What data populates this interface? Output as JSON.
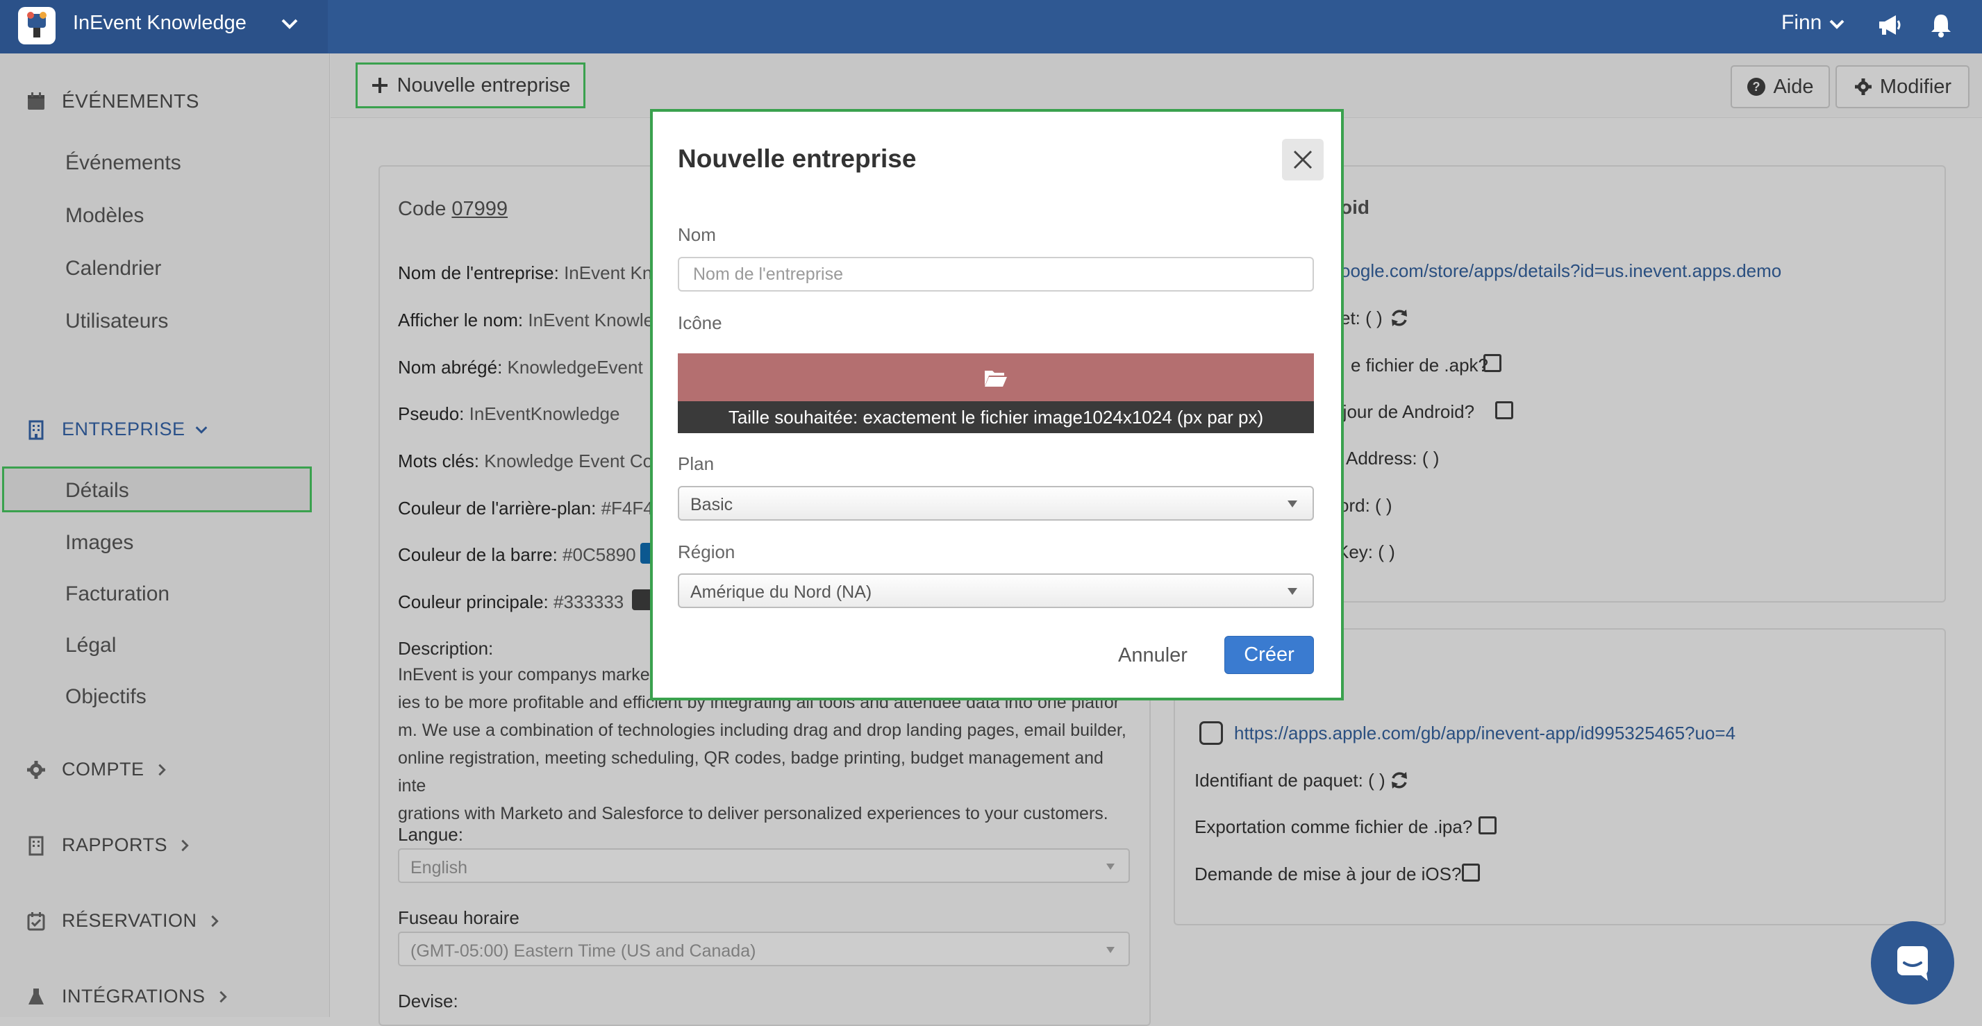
{
  "app": {
    "title": "InEvent Knowledge"
  },
  "user": {
    "name": "Finn"
  },
  "sidebar": {
    "events_header": "ÉVÉNEMENTS",
    "events_items": [
      "Événements",
      "Modèles",
      "Calendrier",
      "Utilisateurs"
    ],
    "company_header": "ENTREPRISE",
    "company_items": [
      "Détails",
      "Images",
      "Facturation",
      "Légal",
      "Objectifs"
    ],
    "account_header": "COMPTE",
    "reports_header": "RAPPORTS",
    "reservation_header": "RÉSERVATION",
    "integrations_header": "INTÉGRATIONS"
  },
  "toolbar": {
    "new_company": "Nouvelle entreprise",
    "help": "Aide",
    "edit": "Modifier"
  },
  "details": {
    "code_label": "Code",
    "code_value": "07999",
    "company_name_label": "Nom de l'entreprise:",
    "company_name_value": "InEvent Kno",
    "display_name_label": "Afficher le nom:",
    "display_name_value": "InEvent Knowle",
    "short_name_label": "Nom abrégé:",
    "short_name_value": "KnowledgeEvent",
    "nickname_label": "Pseudo:",
    "nickname_value": "InEventKnowledge",
    "keywords_label": "Mots clés:",
    "keywords_value": "Knowledge Event Cor",
    "bg_color_label": "Couleur de l'arrière-plan:",
    "bg_color_value": "#F4F4",
    "bar_color_label": "Couleur de la barre:",
    "bar_color_value": "#0C5890",
    "main_color_label": "Couleur principale:",
    "main_color_value": "#333333",
    "description_label": "Description:",
    "description_lines": [
      "InEvent is your companys market",
      "ies to be more profitable and efficient by integrating all tools and attendee data into one platfor",
      "m. We use a combination of technologies including drag and drop landing pages, email builder,",
      "online registration, meeting scheduling, QR codes, badge printing, budget management and inte",
      "grations with Marketo and Salesforce to deliver personalized experiences to your customers."
    ],
    "language_label": "Langue:",
    "language_value": "English",
    "timezone_label": "Fuseau horaire",
    "timezone_value": "(GMT-05:00) Eastern Time (US and Canada)",
    "currency_label": "Devise:"
  },
  "android": {
    "title": "oid",
    "store_link": "oogle.com/store/apps/details?id=us.inevent.apps.demo",
    "package_label": "et: ( )",
    "export_label": "e fichier de .apk?",
    "update_label": "à jour de Android?",
    "address_label": "Address: ( )",
    "password_label": "ord: ( )",
    "key_label": "Key: ( )"
  },
  "ios": {
    "store_link": "https://apps.apple.com/gb/app/inevent-app/id995325465?uo=4",
    "package_label": "Identifiant de paquet: ( )",
    "export_label": "Exportation comme fichier de .ipa?",
    "update_label": "Demande de mise à jour de iOS?"
  },
  "modal": {
    "title": "Nouvelle entreprise",
    "name_label": "Nom",
    "name_placeholder": "Nom de l'entreprise",
    "icon_label": "Icône",
    "size_hint": "Taille souhaitée: exactement le fichier image1024x1024 (px par px)",
    "plan_label": "Plan",
    "plan_value": "Basic",
    "region_label": "Région",
    "region_value": "Amérique du Nord (NA)",
    "cancel": "Annuler",
    "create": "Créer"
  },
  "colors": {
    "topbar": "#2f5892",
    "highlight": "#3aa14e",
    "primary_button": "#3a7bd0",
    "upload_bar": "#b46f70"
  }
}
